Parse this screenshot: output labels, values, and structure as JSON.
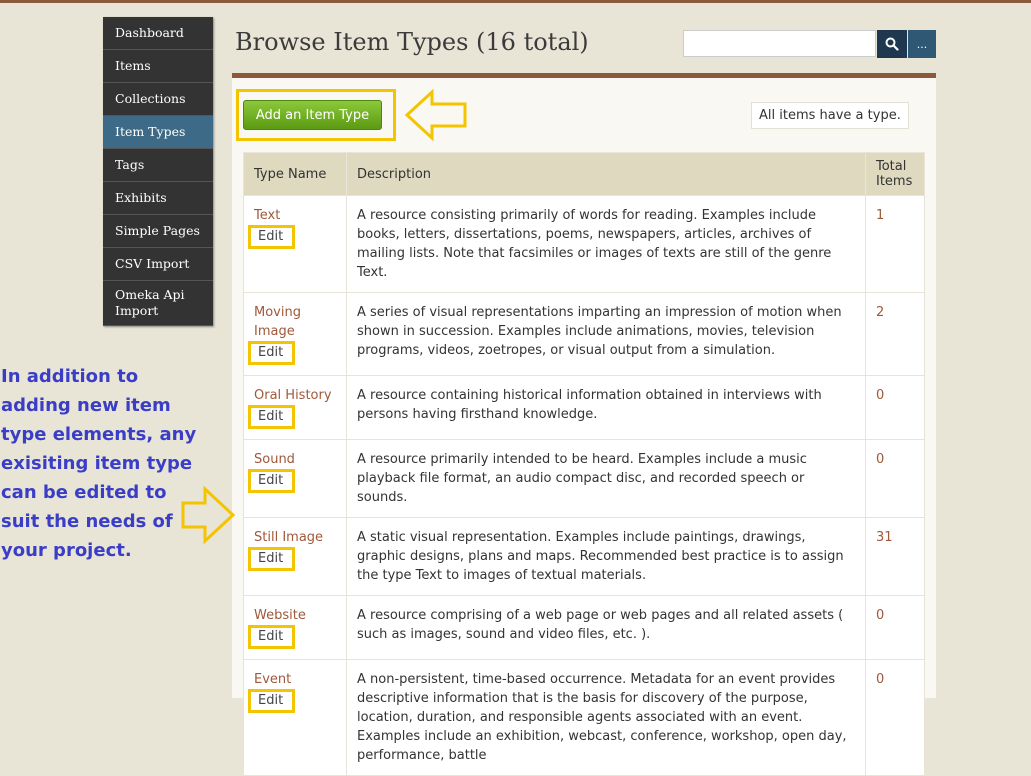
{
  "nav": {
    "items": [
      {
        "label": "Dashboard",
        "active": false
      },
      {
        "label": "Items",
        "active": false
      },
      {
        "label": "Collections",
        "active": false
      },
      {
        "label": "Item Types",
        "active": true
      },
      {
        "label": "Tags",
        "active": false
      },
      {
        "label": "Exhibits",
        "active": false
      },
      {
        "label": "Simple Pages",
        "active": false
      },
      {
        "label": "CSV Import",
        "active": false
      },
      {
        "label": "Omeka Api Import",
        "active": false
      }
    ]
  },
  "header": {
    "title": "Browse Item Types (16 total)",
    "search_value": "",
    "search_icon": "search-icon",
    "more_label": "..."
  },
  "toolbar": {
    "add_label": "Add an Item Type",
    "note": "All items have a type."
  },
  "table": {
    "headers": {
      "name": "Type Name",
      "description": "Description",
      "total": "Total Items"
    },
    "edit_label": "Edit",
    "rows": [
      {
        "name": "Text",
        "description": "A resource consisting primarily of words for reading. Examples include books, letters, dissertations, poems, newspapers, articles, archives of mailing lists. Note that facsimiles or images of texts are still of the genre Text.",
        "total": "1"
      },
      {
        "name": "Moving Image",
        "description": "A series of visual representations imparting an impression of motion when shown in succession. Examples include animations, movies, television programs, videos, zoetropes, or visual output from a simulation.",
        "total": "2"
      },
      {
        "name": "Oral History",
        "description": "A resource containing historical information obtained in interviews with persons having firsthand knowledge.",
        "total": "0"
      },
      {
        "name": "Sound",
        "description": "A resource primarily intended to be heard. Examples include a music playback file format, an audio compact disc, and recorded speech or sounds.",
        "total": "0"
      },
      {
        "name": "Still Image",
        "description": "A static visual representation. Examples include paintings, drawings, graphic designs, plans and maps. Recommended best practice is to assign the type Text to images of textual materials.",
        "total": "31"
      },
      {
        "name": "Website",
        "description": "A resource comprising of a web page or web pages and all related assets ( such as images, sound and video files, etc. ).",
        "total": "0"
      },
      {
        "name": "Event",
        "description": "A non-persistent, time-based occurrence. Metadata for an event provides descriptive information that is the basis for discovery of the purpose, location, duration, and responsible agents associated with an event. Examples include an exhibition, webcast, conference, workshop, open day, performance, battle",
        "total": "0"
      }
    ]
  },
  "annotation": {
    "text": "In addition to adding new item type elements, any exisiting item type can be edited to suit the needs of your project."
  },
  "colors": {
    "highlight": "#f5c400",
    "link": "#a0583a",
    "nav_active": "#3d6a86",
    "annotation": "#3a3ec7",
    "add_button": "#6aad1f"
  }
}
